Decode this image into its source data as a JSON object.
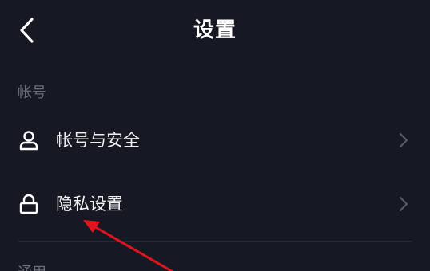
{
  "header": {
    "title": "设置",
    "back_icon": "chevron-left-icon"
  },
  "sections": [
    {
      "title": "帐号",
      "items": [
        {
          "label": "帐号与安全",
          "icon": "user-icon"
        },
        {
          "label": "隐私设置",
          "icon": "lock-icon"
        }
      ]
    },
    {
      "title": "通用"
    }
  ],
  "colors": {
    "background": "#161823",
    "section_text": "#6b6d77",
    "chevron": "#5a5c66",
    "annotation_arrow": "#e0141e"
  }
}
